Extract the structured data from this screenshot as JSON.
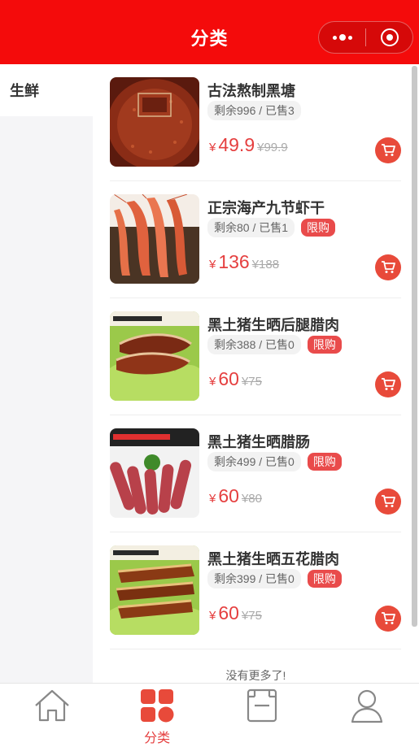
{
  "header": {
    "title": "分类"
  },
  "sidebar": {
    "items": [
      {
        "label": "生鲜"
      }
    ]
  },
  "products": [
    {
      "name": "古法熬制黑塘",
      "stock": "剩余996 / 已售3",
      "limit": "",
      "currency": "¥",
      "price": "49.9",
      "original": "¥99.9",
      "image": "brown-sugar-block"
    },
    {
      "name": "正宗海产九节虾干",
      "stock": "剩余80 / 已售1",
      "limit": "限购",
      "currency": "¥",
      "price": "136",
      "original": "¥188",
      "image": "dried-shrimp"
    },
    {
      "name": "黑土猪生晒后腿腊肉",
      "stock": "剩余388 / 已售0",
      "limit": "限购",
      "currency": "¥",
      "price": "60",
      "original": "¥75",
      "image": "cured-pork-leg"
    },
    {
      "name": "黑土猪生晒腊肠",
      "stock": "剩余499 / 已售0",
      "limit": "限购",
      "currency": "¥",
      "price": "60",
      "original": "¥80",
      "image": "sausages"
    },
    {
      "name": "黑土猪生晒五花腊肉",
      "stock": "剩余399 / 已售0",
      "limit": "限购",
      "currency": "¥",
      "price": "60",
      "original": "¥75",
      "image": "cured-pork-belly"
    }
  ],
  "footer_note": "没有更多了!",
  "tabbar": {
    "tabs": [
      {
        "name": "home",
        "label": ""
      },
      {
        "name": "category",
        "label": "分类",
        "active": true
      },
      {
        "name": "cart",
        "label": ""
      },
      {
        "name": "profile",
        "label": ""
      }
    ]
  },
  "colors": {
    "header": "#f40b0b",
    "accent": "#e53f3f",
    "cart_button": "#e84a3a"
  }
}
